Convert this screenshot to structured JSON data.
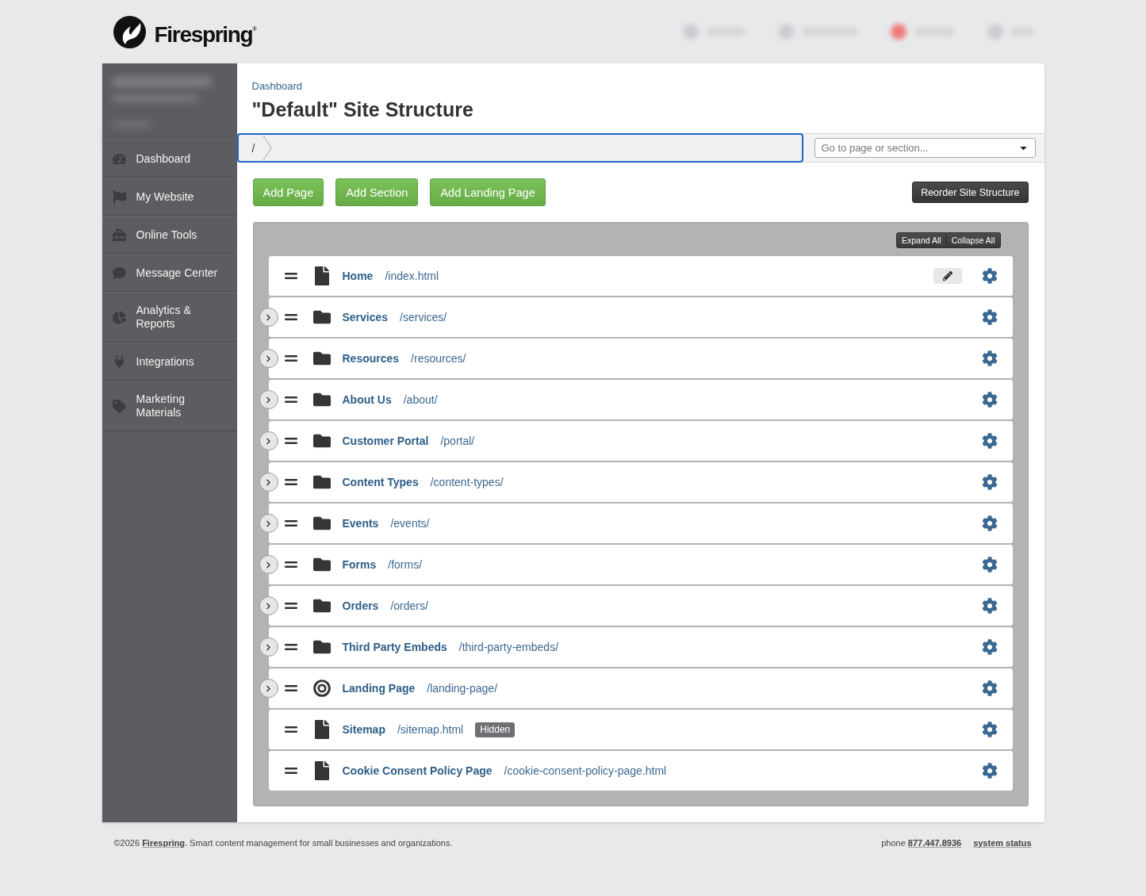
{
  "header": {
    "logo": "Firespring$^{®}$",
    "blurred_nav": [
      {
        "alert": false
      },
      {
        "alert": false
      },
      {
        "alert": true
      },
      {
        "alert": false
      }
    ]
  },
  "sidebar": {
    "items": [
      {
        "label": "Dashboard"
      },
      {
        "label": "My Website"
      },
      {
        "label": "Online Tools"
      },
      {
        "label": "Message Center"
      },
      {
        "label": "Analytics & Reports"
      },
      {
        "label": "Integrations"
      },
      {
        "label": "Marketing Materials"
      }
    ]
  },
  "page": {
    "breadcrumb": "Dashboard",
    "title": "\"Default\" Site Structure"
  },
  "path_bar": {
    "segments": [
      "/"
    ],
    "jump_select": {
      "placeholder": "Go to page or section..."
    }
  },
  "actions": {
    "add_buttons": [
      "Add Page",
      "Add Section",
      "Add Landing Page"
    ],
    "reorder_button": "Reorder Site Structure"
  },
  "tree": {
    "controls": [
      "Expand All",
      "Collapse All"
    ],
    "rows": [
      {
        "kind": "page",
        "name": "Home",
        "path": "/index.html",
        "edit_button": true
      },
      {
        "kind": "section",
        "name": "Services",
        "path": "/services/",
        "expanded": false,
        "edit_button": false
      },
      {
        "kind": "section",
        "name": "Resources",
        "path": "/resources/",
        "expanded": false,
        "edit_button": false
      },
      {
        "kind": "section",
        "name": "About Us",
        "path": "/about/",
        "expanded": false,
        "edit_button": false
      },
      {
        "kind": "section",
        "name": "Customer Portal",
        "path": "/portal/",
        "expanded": false,
        "edit_button": false
      },
      {
        "kind": "section",
        "name": "Content Types",
        "path": "/content-types/",
        "expanded": false,
        "edit_button": false
      },
      {
        "kind": "section",
        "name": "Events",
        "path": "/events/",
        "expanded": false,
        "edit_button": false
      },
      {
        "kind": "section",
        "name": "Forms",
        "path": "/forms/",
        "expanded": false,
        "edit_button": false
      },
      {
        "kind": "section",
        "name": "Orders",
        "path": "/orders/",
        "expanded": false,
        "edit_button": false
      },
      {
        "kind": "section",
        "name": "Third Party Embeds",
        "path": "/third-party-embeds/",
        "expanded": false,
        "edit_button": false
      },
      {
        "kind": "landing",
        "name": "Landing Page",
        "path": "/landing-page/",
        "expanded": false,
        "edit_button": false
      },
      {
        "kind": "page",
        "name": "Sitemap",
        "path": "/sitemap.html",
        "badge": "Hidden",
        "edit_button": false
      },
      {
        "kind": "page",
        "name": "Cookie Consent Policy Page",
        "path": "/cookie-consent-policy-page.html",
        "edit_button": false
      }
    ]
  },
  "footer": {
    "copyright": "©2026",
    "company": "Firespring",
    "tagline": ". Smart content management for small businesses and organizations.",
    "phone_label": "phone",
    "phone": "877.447.8936",
    "status_link": "system status"
  }
}
